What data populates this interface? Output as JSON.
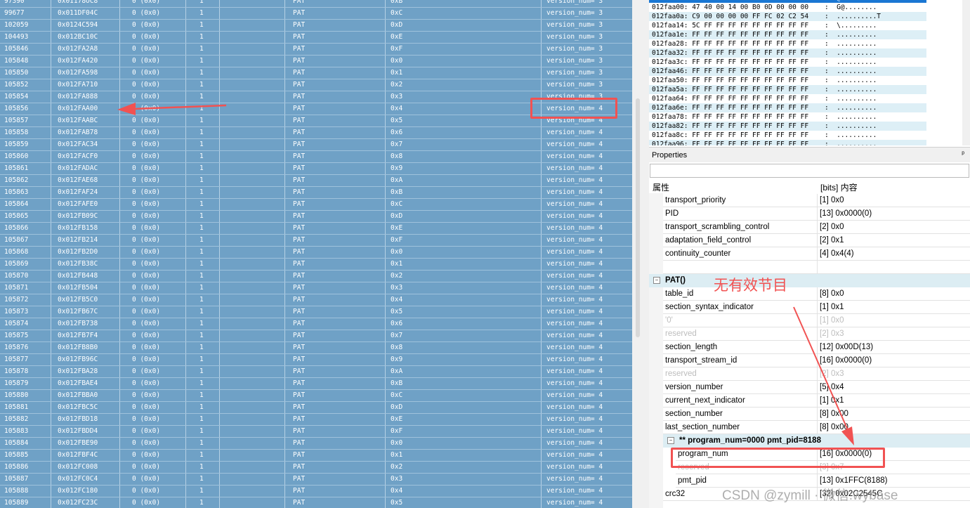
{
  "packets": [
    {
      "index": "97390",
      "offset": "0x01178OC8",
      "c3": "0 (0x0)",
      "c4": "1",
      "type": "PAT",
      "cc": "0xB",
      "version": "version_num= 3"
    },
    {
      "index": "99677",
      "offset": "0x011DF04C",
      "c3": "0 (0x0)",
      "c4": "1",
      "type": "PAT",
      "cc": "0xC",
      "version": "version_num= 3"
    },
    {
      "index": "102059",
      "offset": "0x0124C594",
      "c3": "0 (0x0)",
      "c4": "1",
      "type": "PAT",
      "cc": "0xD",
      "version": "version_num= 3"
    },
    {
      "index": "104493",
      "offset": "0x012BC10C",
      "c3": "0 (0x0)",
      "c4": "1",
      "type": "PAT",
      "cc": "0xE",
      "version": "version_num= 3"
    },
    {
      "index": "105846",
      "offset": "0x012FA2A8",
      "c3": "0 (0x0)",
      "c4": "1",
      "type": "PAT",
      "cc": "0xF",
      "version": "version_num= 3"
    },
    {
      "index": "105848",
      "offset": "0x012FA420",
      "c3": "0 (0x0)",
      "c4": "1",
      "type": "PAT",
      "cc": "0x0",
      "version": "version_num= 3"
    },
    {
      "index": "105850",
      "offset": "0x012FA598",
      "c3": "0 (0x0)",
      "c4": "1",
      "type": "PAT",
      "cc": "0x1",
      "version": "version_num= 3"
    },
    {
      "index": "105852",
      "offset": "0x012FA710",
      "c3": "0 (0x0)",
      "c4": "1",
      "type": "PAT",
      "cc": "0x2",
      "version": "version_num= 3"
    },
    {
      "index": "105854",
      "offset": "0x012FA888",
      "c3": "0 (0x0)",
      "c4": "1",
      "type": "PAT",
      "cc": "0x3",
      "version": "version_num= 3"
    },
    {
      "index": "105856",
      "offset": "0x012FAA00",
      "c3": "0 (0x0)",
      "c4": "1",
      "type": "PAT",
      "cc": "0x4",
      "version": "version_num= 4"
    },
    {
      "index": "105857",
      "offset": "0x012FAABC",
      "c3": "0 (0x0)",
      "c4": "1",
      "type": "PAT",
      "cc": "0x5",
      "version": "version_num= 4"
    },
    {
      "index": "105858",
      "offset": "0x012FAB78",
      "c3": "0 (0x0)",
      "c4": "1",
      "type": "PAT",
      "cc": "0x6",
      "version": "version_num= 4"
    },
    {
      "index": "105859",
      "offset": "0x012FAC34",
      "c3": "0 (0x0)",
      "c4": "1",
      "type": "PAT",
      "cc": "0x7",
      "version": "version_num= 4"
    },
    {
      "index": "105860",
      "offset": "0x012FACF0",
      "c3": "0 (0x0)",
      "c4": "1",
      "type": "PAT",
      "cc": "0x8",
      "version": "version_num= 4"
    },
    {
      "index": "105861",
      "offset": "0x012FADAC",
      "c3": "0 (0x0)",
      "c4": "1",
      "type": "PAT",
      "cc": "0x9",
      "version": "version_num= 4"
    },
    {
      "index": "105862",
      "offset": "0x012FAE68",
      "c3": "0 (0x0)",
      "c4": "1",
      "type": "PAT",
      "cc": "0xA",
      "version": "version_num= 4"
    },
    {
      "index": "105863",
      "offset": "0x012FAF24",
      "c3": "0 (0x0)",
      "c4": "1",
      "type": "PAT",
      "cc": "0xB",
      "version": "version_num= 4"
    },
    {
      "index": "105864",
      "offset": "0x012FAFE0",
      "c3": "0 (0x0)",
      "c4": "1",
      "type": "PAT",
      "cc": "0xC",
      "version": "version_num= 4"
    },
    {
      "index": "105865",
      "offset": "0x012FB09C",
      "c3": "0 (0x0)",
      "c4": "1",
      "type": "PAT",
      "cc": "0xD",
      "version": "version_num= 4"
    },
    {
      "index": "105866",
      "offset": "0x012FB158",
      "c3": "0 (0x0)",
      "c4": "1",
      "type": "PAT",
      "cc": "0xE",
      "version": "version_num= 4"
    },
    {
      "index": "105867",
      "offset": "0x012FB214",
      "c3": "0 (0x0)",
      "c4": "1",
      "type": "PAT",
      "cc": "0xF",
      "version": "version_num= 4"
    },
    {
      "index": "105868",
      "offset": "0x012FB2D0",
      "c3": "0 (0x0)",
      "c4": "1",
      "type": "PAT",
      "cc": "0x0",
      "version": "version_num= 4"
    },
    {
      "index": "105869",
      "offset": "0x012FB38C",
      "c3": "0 (0x0)",
      "c4": "1",
      "type": "PAT",
      "cc": "0x1",
      "version": "version_num= 4"
    },
    {
      "index": "105870",
      "offset": "0x012FB448",
      "c3": "0 (0x0)",
      "c4": "1",
      "type": "PAT",
      "cc": "0x2",
      "version": "version_num= 4"
    },
    {
      "index": "105871",
      "offset": "0x012FB504",
      "c3": "0 (0x0)",
      "c4": "1",
      "type": "PAT",
      "cc": "0x3",
      "version": "version_num= 4"
    },
    {
      "index": "105872",
      "offset": "0x012FB5C0",
      "c3": "0 (0x0)",
      "c4": "1",
      "type": "PAT",
      "cc": "0x4",
      "version": "version_num= 4"
    },
    {
      "index": "105873",
      "offset": "0x012FB67C",
      "c3": "0 (0x0)",
      "c4": "1",
      "type": "PAT",
      "cc": "0x5",
      "version": "version_num= 4"
    },
    {
      "index": "105874",
      "offset": "0x012FB738",
      "c3": "0 (0x0)",
      "c4": "1",
      "type": "PAT",
      "cc": "0x6",
      "version": "version_num= 4"
    },
    {
      "index": "105875",
      "offset": "0x012FB7F4",
      "c3": "0 (0x0)",
      "c4": "1",
      "type": "PAT",
      "cc": "0x7",
      "version": "version_num= 4"
    },
    {
      "index": "105876",
      "offset": "0x012FB8B0",
      "c3": "0 (0x0)",
      "c4": "1",
      "type": "PAT",
      "cc": "0x8",
      "version": "version_num= 4"
    },
    {
      "index": "105877",
      "offset": "0x012FB96C",
      "c3": "0 (0x0)",
      "c4": "1",
      "type": "PAT",
      "cc": "0x9",
      "version": "version_num= 4"
    },
    {
      "index": "105878",
      "offset": "0x012FBA28",
      "c3": "0 (0x0)",
      "c4": "1",
      "type": "PAT",
      "cc": "0xA",
      "version": "version_num= 4"
    },
    {
      "index": "105879",
      "offset": "0x012FBAE4",
      "c3": "0 (0x0)",
      "c4": "1",
      "type": "PAT",
      "cc": "0xB",
      "version": "version_num= 4"
    },
    {
      "index": "105880",
      "offset": "0x012FBBA0",
      "c3": "0 (0x0)",
      "c4": "1",
      "type": "PAT",
      "cc": "0xC",
      "version": "version_num= 4"
    },
    {
      "index": "105881",
      "offset": "0x012FBC5C",
      "c3": "0 (0x0)",
      "c4": "1",
      "type": "PAT",
      "cc": "0xD",
      "version": "version_num= 4"
    },
    {
      "index": "105882",
      "offset": "0x012FBD18",
      "c3": "0 (0x0)",
      "c4": "1",
      "type": "PAT",
      "cc": "0xE",
      "version": "version_num= 4"
    },
    {
      "index": "105883",
      "offset": "0x012FBDD4",
      "c3": "0 (0x0)",
      "c4": "1",
      "type": "PAT",
      "cc": "0xF",
      "version": "version_num= 4"
    },
    {
      "index": "105884",
      "offset": "0x012FBE90",
      "c3": "0 (0x0)",
      "c4": "1",
      "type": "PAT",
      "cc": "0x0",
      "version": "version_num= 4"
    },
    {
      "index": "105885",
      "offset": "0x012FBF4C",
      "c3": "0 (0x0)",
      "c4": "1",
      "type": "PAT",
      "cc": "0x1",
      "version": "version_num= 4"
    },
    {
      "index": "105886",
      "offset": "0x012FC008",
      "c3": "0 (0x0)",
      "c4": "1",
      "type": "PAT",
      "cc": "0x2",
      "version": "version_num= 4"
    },
    {
      "index": "105887",
      "offset": "0x012FC0C4",
      "c3": "0 (0x0)",
      "c4": "1",
      "type": "PAT",
      "cc": "0x3",
      "version": "version_num= 4"
    },
    {
      "index": "105888",
      "offset": "0x012FC180",
      "c3": "0 (0x0)",
      "c4": "1",
      "type": "PAT",
      "cc": "0x4",
      "version": "version_num= 4"
    },
    {
      "index": "105889",
      "offset": "0x012FC23C",
      "c3": "0 (0x0)",
      "c4": "1",
      "type": "PAT",
      "cc": "0x5",
      "version": "version_num= 4"
    }
  ],
  "hex": [
    {
      "line": "012fa9f6: 47 40 00 14 00 B0 0D 00 00 00    : G@........",
      "selected": true
    },
    {
      "line": "012faa00: 47 40 00 14 00 B0 0D 00 00 00    :  G@........"
    },
    {
      "line": "012faa0a: C9 00 00 00 00 FF FC 02 C2 54    :  ..........T"
    },
    {
      "line": "012faa14: 5C FF FF FF FF FF FF FF FF FF    :  \\........."
    },
    {
      "line": "012faa1e: FF FF FF FF FF FF FF FF FF FF    :  .........."
    },
    {
      "line": "012faa28: FF FF FF FF FF FF FF FF FF FF    :  .........."
    },
    {
      "line": "012faa32: FF FF FF FF FF FF FF FF FF FF    :  .........."
    },
    {
      "line": "012faa3c: FF FF FF FF FF FF FF FF FF FF    :  .........."
    },
    {
      "line": "012faa46: FF FF FF FF FF FF FF FF FF FF    :  .........."
    },
    {
      "line": "012faa50: FF FF FF FF FF FF FF FF FF FF    :  .........."
    },
    {
      "line": "012faa5a: FF FF FF FF FF FF FF FF FF FF    :  .........."
    },
    {
      "line": "012faa64: FF FF FF FF FF FF FF FF FF FF    :  .........."
    },
    {
      "line": "012faa6e: FF FF FF FF FF FF FF FF FF FF    :  .........."
    },
    {
      "line": "012faa78: FF FF FF FF FF FF FF FF FF FF    :  .........."
    },
    {
      "line": "012faa82: FF FF FF FF FF FF FF FF FF FF    :  .........."
    },
    {
      "line": "012faa8c: FF FF FF FF FF FF FF FF FF FF    :  .........."
    },
    {
      "line": "012faa96: FF FF FF FF FF FF FF FF FF FF    :  .........."
    }
  ],
  "props": {
    "title": "Properties",
    "pin": "ᵖ",
    "col_key": "属性",
    "col_val": "[bits] 内容",
    "rows": [
      {
        "kind": "row",
        "k": "transport_priority",
        "v": "[1] 0x0"
      },
      {
        "kind": "row",
        "k": "PID",
        "v": "[13] 0x0000(0)"
      },
      {
        "kind": "row",
        "k": "transport_scrambling_control",
        "v": "[2] 0x0"
      },
      {
        "kind": "row",
        "k": "adaptation_field_control",
        "v": "[2] 0x1"
      },
      {
        "kind": "row",
        "k": "continuity_counter",
        "v": "[4] 0x4(4)"
      },
      {
        "kind": "row",
        "k": "",
        "v": ""
      },
      {
        "kind": "group",
        "k": "PAT()",
        "toggle": "−"
      },
      {
        "kind": "row",
        "k": "table_id",
        "v": "[8]  0x0"
      },
      {
        "kind": "row",
        "k": "section_syntax_indicator",
        "v": "[1]  0x1"
      },
      {
        "kind": "row",
        "k": "'0'",
        "v": "[1]  0x0",
        "dim": true
      },
      {
        "kind": "row",
        "k": "reserved",
        "v": "[2]  0x3",
        "dim": true
      },
      {
        "kind": "row",
        "k": "section_length",
        "v": "[12] 0x00D(13)"
      },
      {
        "kind": "row",
        "k": "transport_stream_id",
        "v": "[16] 0x0000(0)"
      },
      {
        "kind": "row",
        "k": "reserved",
        "v": "[2]  0x3",
        "dim": true
      },
      {
        "kind": "row",
        "k": "version_number",
        "v": "[5]  0x4"
      },
      {
        "kind": "row",
        "k": "current_next_indicator",
        "v": "[1]  0x1"
      },
      {
        "kind": "row",
        "k": "section_number",
        "v": "[8]  0x00"
      },
      {
        "kind": "row",
        "k": "last_section_number",
        "v": "[8]  0x00"
      },
      {
        "kind": "subgroup",
        "k": "** program_num=0000 pmt_pid=8188",
        "toggle": "−"
      },
      {
        "kind": "subrow",
        "k": "program_num",
        "v": "[16] 0x0000(0)"
      },
      {
        "kind": "subrow",
        "k": "reserved",
        "v": "[3]  0x7",
        "dim": true
      },
      {
        "kind": "subrow",
        "k": "pmt_pid",
        "v": "[13] 0x1FFC(8188)"
      },
      {
        "kind": "row",
        "k": "crc32",
        "v": "[32] 0x02C2545C"
      }
    ]
  },
  "annotation": {
    "text": "无有效节目",
    "color": "#f15252"
  },
  "watermark": "CSDN @zymill · 微信:wybase"
}
